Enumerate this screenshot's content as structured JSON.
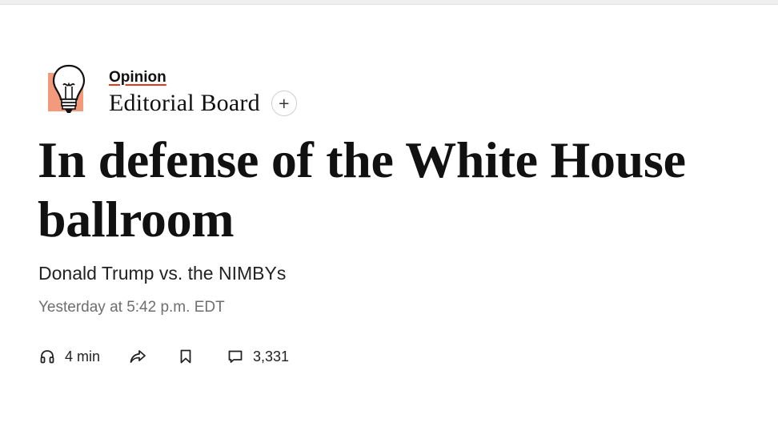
{
  "header": {
    "logo_icon": "lightbulb-icon",
    "section_label": "Opinion",
    "author": "Editorial Board",
    "follow_icon": "plus-icon",
    "follow_symbol": "+"
  },
  "article": {
    "headline": "In defense of the White House ballroom",
    "dek": "Donald Trump vs. the NIMBYs",
    "timestamp": "Yesterday at 5:42 p.m. EDT"
  },
  "actions": {
    "listen": {
      "icon": "headphones-icon",
      "label": "4 min"
    },
    "share": {
      "icon": "share-arrow-icon"
    },
    "save": {
      "icon": "bookmark-icon"
    },
    "comments": {
      "icon": "comment-icon",
      "label": "3,331"
    }
  },
  "colors": {
    "accent_underline": "#e2381b",
    "logo_square": "#f29a7b",
    "text": "#111111",
    "muted": "#6e6e6e"
  }
}
